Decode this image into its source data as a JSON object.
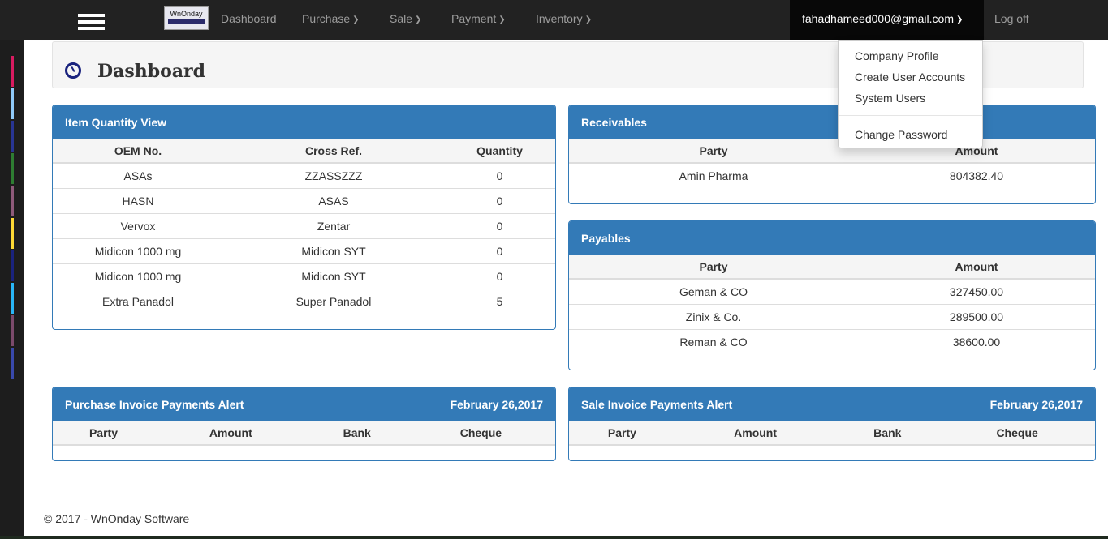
{
  "logo": {
    "text": "WnOnday"
  },
  "nav": {
    "dashboard": "Dashboard",
    "purchase": "Purchase",
    "sale": "Sale",
    "payment": "Payment",
    "inventory": "Inventory",
    "user_email": "fahadhameed000@gmail.com",
    "logoff": "Log off"
  },
  "user_menu": {
    "items": [
      "Company Profile",
      "Create User Accounts",
      "System Users",
      "Change Password"
    ]
  },
  "page": {
    "title": "Dashboard"
  },
  "item_quantity": {
    "title": "Item Quantity View",
    "headers": [
      "OEM No.",
      "Cross Ref.",
      "Quantity"
    ],
    "rows": [
      [
        "ASAs",
        "ZZASSZZZ",
        "0"
      ],
      [
        "HASN",
        "ASAS",
        "0"
      ],
      [
        "Vervox",
        "Zentar",
        "0"
      ],
      [
        "Midicon 1000 mg",
        "Midicon SYT",
        "0"
      ],
      [
        "Midicon 1000 mg",
        "Midicon SYT",
        "0"
      ],
      [
        "Extra Panadol",
        "Super Panadol",
        "5"
      ]
    ]
  },
  "receivables": {
    "title": "Receivables",
    "headers": [
      "Party",
      "Amount"
    ],
    "rows": [
      [
        "Amin Pharma",
        "804382.40"
      ]
    ]
  },
  "payables": {
    "title": "Payables",
    "headers": [
      "Party",
      "Amount"
    ],
    "rows": [
      [
        "Geman & CO",
        "327450.00"
      ],
      [
        "Zinix & Co.",
        "289500.00"
      ],
      [
        "Reman & CO",
        "38600.00"
      ]
    ]
  },
  "purchase_alert": {
    "title": "Purchase Invoice Payments Alert",
    "date": "February 26,2017",
    "headers": [
      "Party",
      "Amount",
      "Bank",
      "Cheque"
    ]
  },
  "sale_alert": {
    "title": "Sale Invoice Payments Alert",
    "date": "February 26,2017",
    "headers": [
      "Party",
      "Amount",
      "Bank",
      "Cheque"
    ]
  },
  "footer": {
    "text": "© 2017 - WnOnday Software"
  },
  "colors": {
    "navbar": "#222222",
    "panel_primary": "#337ab7",
    "strip_accents": [
      "#d81b60",
      "#90caf9",
      "#283593",
      "#2e7d32",
      "#8e5a7a",
      "#fdd835",
      "#1a237e",
      "#29b6f6",
      "#7b4a6b",
      "#3949ab"
    ]
  }
}
